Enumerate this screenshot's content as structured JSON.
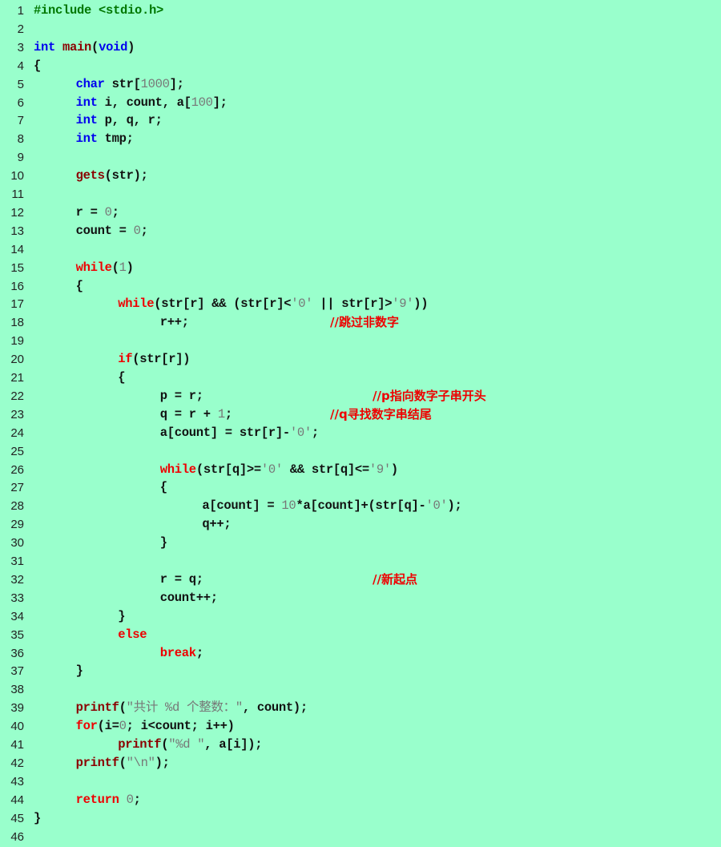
{
  "editor": {
    "background": "#99ffcc",
    "colors": {
      "preproc": "#007700",
      "type": "#0000ee",
      "func": "#8b0000",
      "keyword": "#ee0000",
      "number": "#777777",
      "string": "#777777",
      "comment": "#ee0000",
      "plain": "#111111"
    },
    "lines": [
      {
        "n": "1",
        "indent": 0,
        "tokens": [
          [
            "preproc",
            "#include <stdio.h>"
          ]
        ]
      },
      {
        "n": "2",
        "indent": 0,
        "tokens": []
      },
      {
        "n": "3",
        "indent": 0,
        "tokens": [
          [
            "type",
            "int"
          ],
          [
            "plain",
            " "
          ],
          [
            "func",
            "main"
          ],
          [
            "plain",
            "("
          ],
          [
            "type",
            "void"
          ],
          [
            "plain",
            ")"
          ]
        ]
      },
      {
        "n": "4",
        "indent": 0,
        "tokens": [
          [
            "plain",
            "{"
          ]
        ]
      },
      {
        "n": "5",
        "indent": 1,
        "tokens": [
          [
            "type",
            "char"
          ],
          [
            "plain",
            " str["
          ],
          [
            "num",
            "1000"
          ],
          [
            "plain",
            "];"
          ]
        ]
      },
      {
        "n": "6",
        "indent": 1,
        "tokens": [
          [
            "type",
            "int"
          ],
          [
            "plain",
            " i, count, a["
          ],
          [
            "num",
            "100"
          ],
          [
            "plain",
            "];"
          ]
        ]
      },
      {
        "n": "7",
        "indent": 1,
        "tokens": [
          [
            "type",
            "int"
          ],
          [
            "plain",
            " p, q, r;"
          ]
        ]
      },
      {
        "n": "8",
        "indent": 1,
        "tokens": [
          [
            "type",
            "int"
          ],
          [
            "plain",
            " tmp;"
          ]
        ]
      },
      {
        "n": "9",
        "indent": 0,
        "tokens": []
      },
      {
        "n": "10",
        "indent": 1,
        "tokens": [
          [
            "func",
            "gets"
          ],
          [
            "plain",
            "(str);"
          ]
        ]
      },
      {
        "n": "11",
        "indent": 0,
        "tokens": []
      },
      {
        "n": "12",
        "indent": 1,
        "tokens": [
          [
            "plain",
            "r = "
          ],
          [
            "num",
            "0"
          ],
          [
            "plain",
            ";"
          ]
        ]
      },
      {
        "n": "13",
        "indent": 1,
        "tokens": [
          [
            "plain",
            "count = "
          ],
          [
            "num",
            "0"
          ],
          [
            "plain",
            ";"
          ]
        ]
      },
      {
        "n": "14",
        "indent": 0,
        "tokens": []
      },
      {
        "n": "15",
        "indent": 1,
        "tokens": [
          [
            "kw",
            "while"
          ],
          [
            "plain",
            "("
          ],
          [
            "num",
            "1"
          ],
          [
            "plain",
            ")"
          ]
        ]
      },
      {
        "n": "16",
        "indent": 1,
        "tokens": [
          [
            "plain",
            "{"
          ]
        ]
      },
      {
        "n": "17",
        "indent": 2,
        "tokens": [
          [
            "kw",
            "while"
          ],
          [
            "plain",
            "(str[r] && (str[r]<"
          ],
          [
            "str",
            "'0'"
          ],
          [
            "plain",
            " || str[r]>"
          ],
          [
            "str",
            "'9'"
          ],
          [
            "plain",
            "))"
          ]
        ]
      },
      {
        "n": "18",
        "indent": 3,
        "tokens": [
          [
            "plain",
            "r++;"
          ]
        ],
        "comment": "//跳过非数字",
        "comment_col": 0
      },
      {
        "n": "19",
        "indent": 0,
        "tokens": []
      },
      {
        "n": "20",
        "indent": 2,
        "tokens": [
          [
            "kw",
            "if"
          ],
          [
            "plain",
            "(str[r])"
          ]
        ]
      },
      {
        "n": "21",
        "indent": 2,
        "tokens": [
          [
            "plain",
            "{"
          ]
        ]
      },
      {
        "n": "22",
        "indent": 3,
        "tokens": [
          [
            "plain",
            "p = r;"
          ]
        ],
        "comment": "//p指向数字子串开头",
        "comment_col": 1
      },
      {
        "n": "23",
        "indent": 3,
        "tokens": [
          [
            "plain",
            "q = r + "
          ],
          [
            "num",
            "1"
          ],
          [
            "plain",
            ";"
          ]
        ],
        "comment": "//q寻找数字串结尾",
        "comment_col": 0
      },
      {
        "n": "24",
        "indent": 3,
        "tokens": [
          [
            "plain",
            "a[count] = str[r]-"
          ],
          [
            "str",
            "'0'"
          ],
          [
            "plain",
            ";"
          ]
        ]
      },
      {
        "n": "25",
        "indent": 0,
        "tokens": []
      },
      {
        "n": "26",
        "indent": 3,
        "tokens": [
          [
            "kw",
            "while"
          ],
          [
            "plain",
            "(str[q]>="
          ],
          [
            "str",
            "'0'"
          ],
          [
            "plain",
            " && str[q]<="
          ],
          [
            "str",
            "'9'"
          ],
          [
            "plain",
            ")"
          ]
        ]
      },
      {
        "n": "27",
        "indent": 3,
        "tokens": [
          [
            "plain",
            "{"
          ]
        ]
      },
      {
        "n": "28",
        "indent": 4,
        "tokens": [
          [
            "plain",
            "a[count] = "
          ],
          [
            "num",
            "10"
          ],
          [
            "plain",
            "*a[count]+(str[q]-"
          ],
          [
            "str",
            "'0'"
          ],
          [
            "plain",
            ");"
          ]
        ]
      },
      {
        "n": "29",
        "indent": 4,
        "tokens": [
          [
            "plain",
            "q++;"
          ]
        ]
      },
      {
        "n": "30",
        "indent": 3,
        "tokens": [
          [
            "plain",
            "}"
          ]
        ]
      },
      {
        "n": "31",
        "indent": 0,
        "tokens": []
      },
      {
        "n": "32",
        "indent": 3,
        "tokens": [
          [
            "plain",
            "r = q;"
          ]
        ],
        "comment": "//新起点",
        "comment_col": 1
      },
      {
        "n": "33",
        "indent": 3,
        "tokens": [
          [
            "plain",
            "count++;"
          ]
        ]
      },
      {
        "n": "34",
        "indent": 2,
        "tokens": [
          [
            "plain",
            "}"
          ]
        ]
      },
      {
        "n": "35",
        "indent": 2,
        "tokens": [
          [
            "kw",
            "else"
          ]
        ]
      },
      {
        "n": "36",
        "indent": 3,
        "tokens": [
          [
            "kw",
            "break"
          ],
          [
            "plain",
            ";"
          ]
        ]
      },
      {
        "n": "37",
        "indent": 1,
        "tokens": [
          [
            "plain",
            "}"
          ]
        ]
      },
      {
        "n": "38",
        "indent": 0,
        "tokens": []
      },
      {
        "n": "39",
        "indent": 1,
        "tokens": [
          [
            "func",
            "printf"
          ],
          [
            "plain",
            "("
          ],
          [
            "str",
            "\"共计 %d 个整数：\""
          ],
          [
            "plain",
            ", count);"
          ]
        ]
      },
      {
        "n": "40",
        "indent": 1,
        "tokens": [
          [
            "kw",
            "for"
          ],
          [
            "plain",
            "(i="
          ],
          [
            "num",
            "0"
          ],
          [
            "plain",
            "; i<count; i++)"
          ]
        ]
      },
      {
        "n": "41",
        "indent": 2,
        "tokens": [
          [
            "func",
            "printf"
          ],
          [
            "plain",
            "("
          ],
          [
            "str",
            "\"%d \""
          ],
          [
            "plain",
            ", a[i]);"
          ]
        ]
      },
      {
        "n": "42",
        "indent": 1,
        "tokens": [
          [
            "func",
            "printf"
          ],
          [
            "plain",
            "("
          ],
          [
            "str",
            "\"\\n\""
          ],
          [
            "plain",
            ");"
          ]
        ]
      },
      {
        "n": "43",
        "indent": 0,
        "tokens": []
      },
      {
        "n": "44",
        "indent": 1,
        "tokens": [
          [
            "kw",
            "return"
          ],
          [
            "plain",
            " "
          ],
          [
            "num",
            "0"
          ],
          [
            "plain",
            ";"
          ]
        ]
      },
      {
        "n": "45",
        "indent": 0,
        "tokens": [
          [
            "plain",
            "}"
          ]
        ]
      },
      {
        "n": "46",
        "indent": 0,
        "tokens": []
      }
    ]
  }
}
